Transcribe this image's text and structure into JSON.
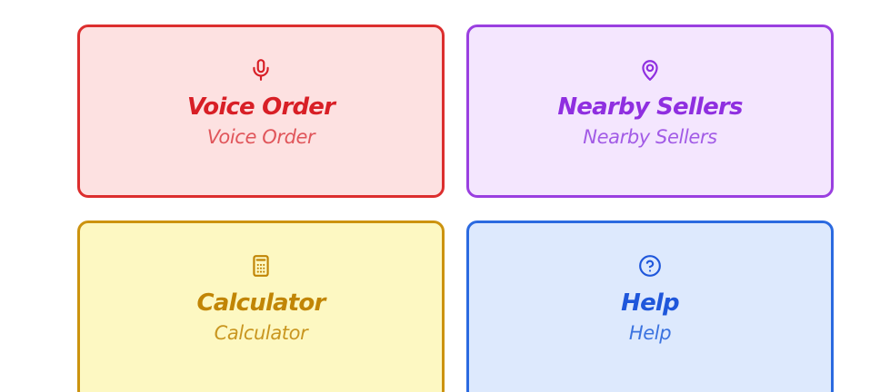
{
  "cards": [
    {
      "icon": "microphone-icon",
      "title": "Voice Order",
      "subtitle": "Voice Order",
      "theme": "red",
      "colors": {
        "background": "#fde1e1",
        "border": "#dc2e2e",
        "text": "#d81f26"
      }
    },
    {
      "icon": "location-pin-icon",
      "title": "Nearby Sellers",
      "subtitle": "Nearby Sellers",
      "theme": "purple",
      "colors": {
        "background": "#f4e6fe",
        "border": "#9a3fe0",
        "text": "#8f2fe0"
      }
    },
    {
      "icon": "calculator-icon",
      "title": "Calculator",
      "subtitle": "Calculator",
      "theme": "yellow",
      "colors": {
        "background": "#fdf8c2",
        "border": "#cc930f",
        "text": "#c18505"
      }
    },
    {
      "icon": "help-circle-icon",
      "title": "Help",
      "subtitle": "Help",
      "theme": "blue",
      "colors": {
        "background": "#dde9fd",
        "border": "#2b6ae0",
        "text": "#1f57db"
      }
    }
  ]
}
